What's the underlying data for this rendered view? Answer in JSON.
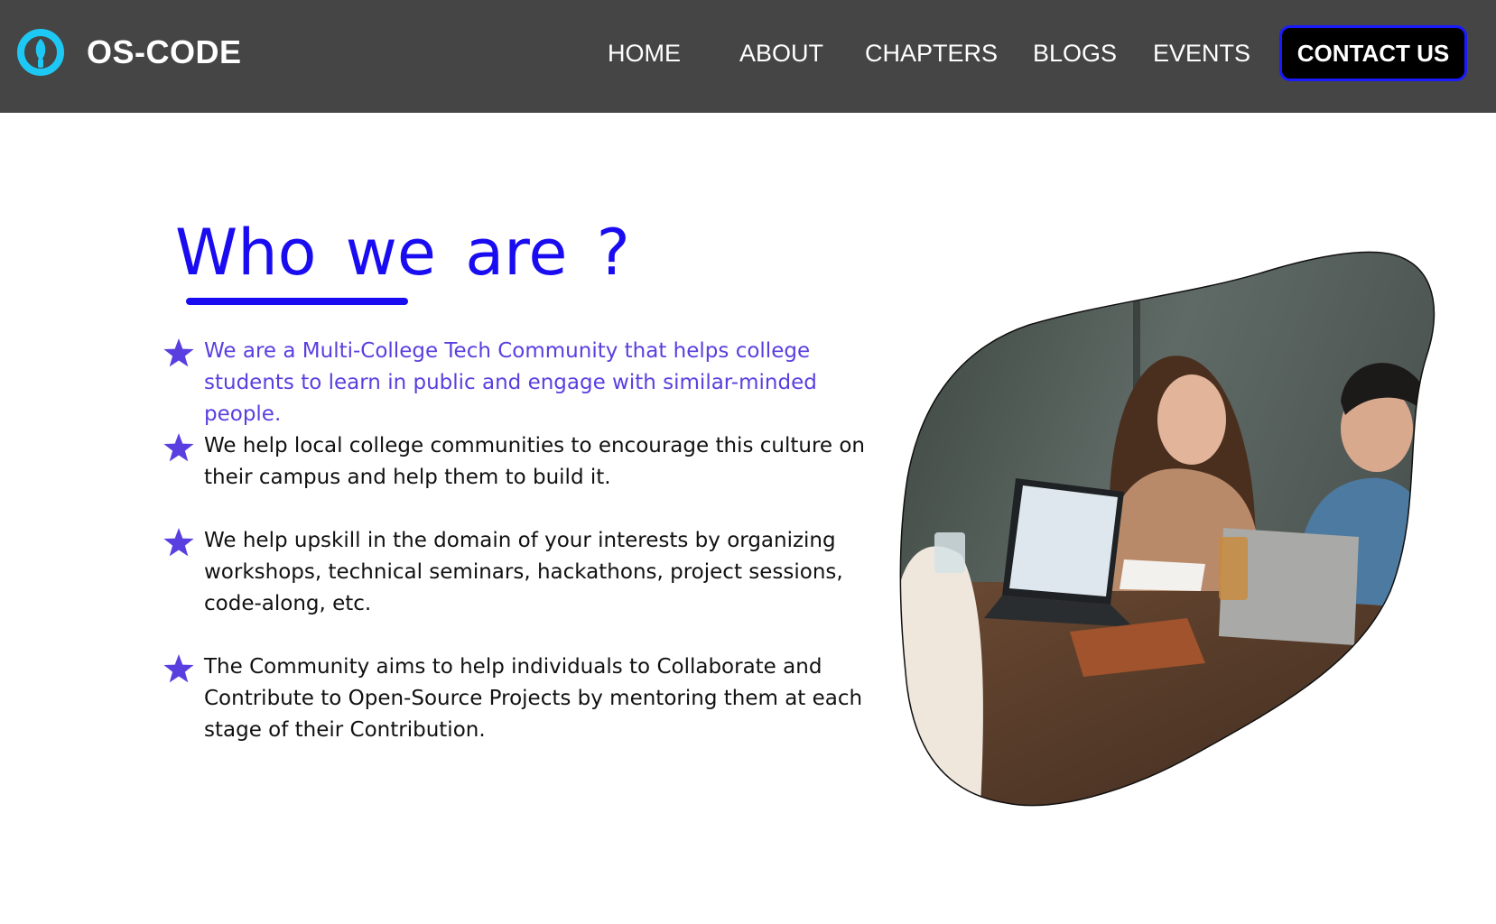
{
  "header": {
    "brand_name": "OS-CODE",
    "nav": [
      {
        "label": "HOME"
      },
      {
        "label": "ABOUT"
      },
      {
        "label": "CHAPTERS"
      },
      {
        "label": "BLOGS"
      },
      {
        "label": "EVENTS"
      }
    ],
    "contact_label": "CONTACT US"
  },
  "main": {
    "title": "Who we are ?",
    "bullets": [
      {
        "text": "We are a Multi-College Tech Community that helps college students to learn in public and engage with similar-minded people."
      },
      {
        "text": "We help local college communities to encourage this culture on their campus and help them to build it."
      },
      {
        "text": "We help upskill in the domain of your interests by organizing workshops, technical seminars, hackathons, project sessions, code-along, etc."
      },
      {
        "text": "The Community aims to help individuals to Collaborate and Contribute to Open-Source Projects by mentoring them at each stage of their Contribution."
      }
    ]
  },
  "icons": {
    "logo": "os-code-logo-icon",
    "bullet": "star-icon"
  },
  "colors": {
    "header_bg": "#454545",
    "title": "#1a0cf0",
    "accent_text": "#5a3fe0",
    "star": "#5a3fe0",
    "logo_ring": "#1ec8f5",
    "button_border": "#1a1aff"
  }
}
